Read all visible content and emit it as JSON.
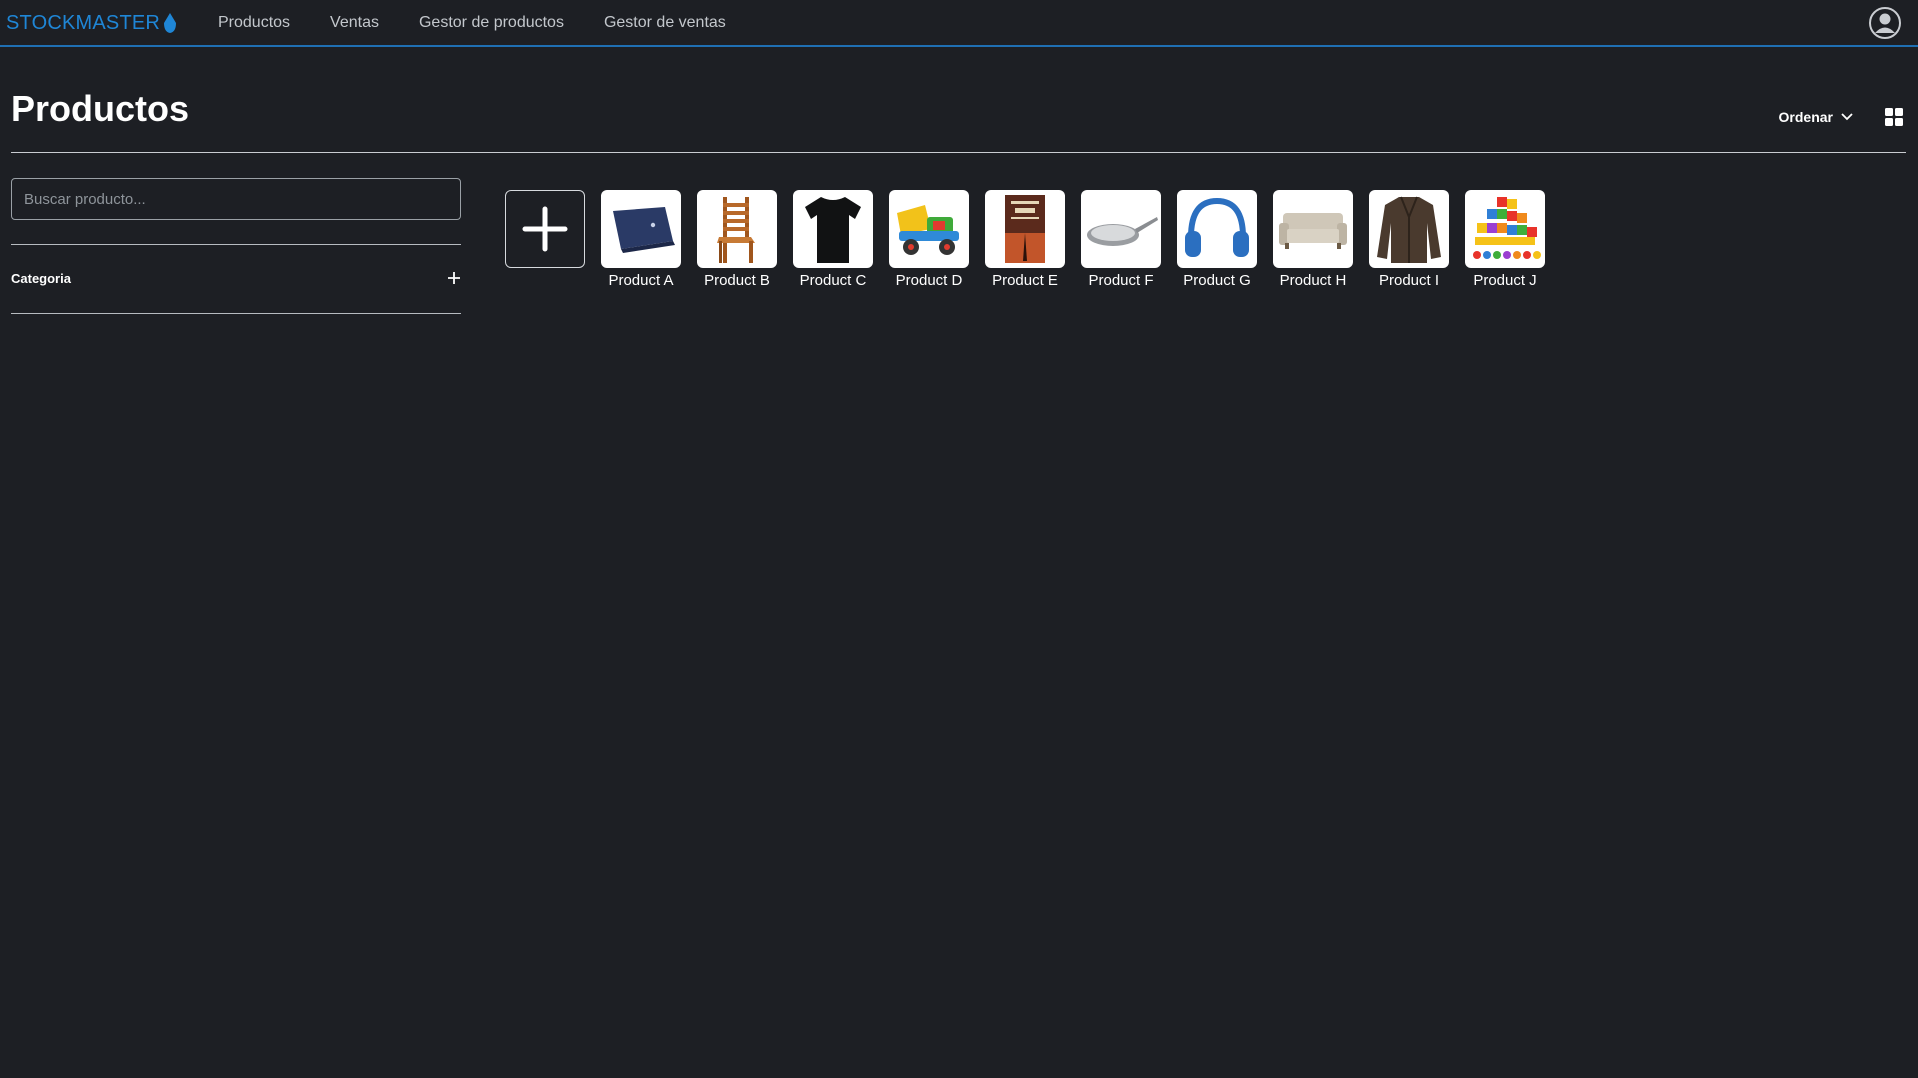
{
  "nav": {
    "brand": "STOCKMASTER",
    "links": [
      "Productos",
      "Ventas",
      "Gestor de productos",
      "Gestor de ventas"
    ]
  },
  "page": {
    "title": "Productos",
    "sort_label": "Ordenar"
  },
  "sidebar": {
    "search_placeholder": "Buscar producto...",
    "category_label": "Categoria"
  },
  "products": [
    {
      "name": "Product A",
      "icon": "laptop-icon"
    },
    {
      "name": "Product B",
      "icon": "chair-icon"
    },
    {
      "name": "Product C",
      "icon": "tshirt-icon"
    },
    {
      "name": "Product D",
      "icon": "toy-truck-icon"
    },
    {
      "name": "Product E",
      "icon": "book-icon"
    },
    {
      "name": "Product F",
      "icon": "frying-pan-icon"
    },
    {
      "name": "Product G",
      "icon": "headphones-icon"
    },
    {
      "name": "Product H",
      "icon": "sofa-icon"
    },
    {
      "name": "Product I",
      "icon": "jacket-icon"
    },
    {
      "name": "Product J",
      "icon": "toy-blocks-icon"
    }
  ],
  "colors": {
    "background": "#1d1f24",
    "accent": "#1f86d6",
    "text": "#ffffff"
  }
}
